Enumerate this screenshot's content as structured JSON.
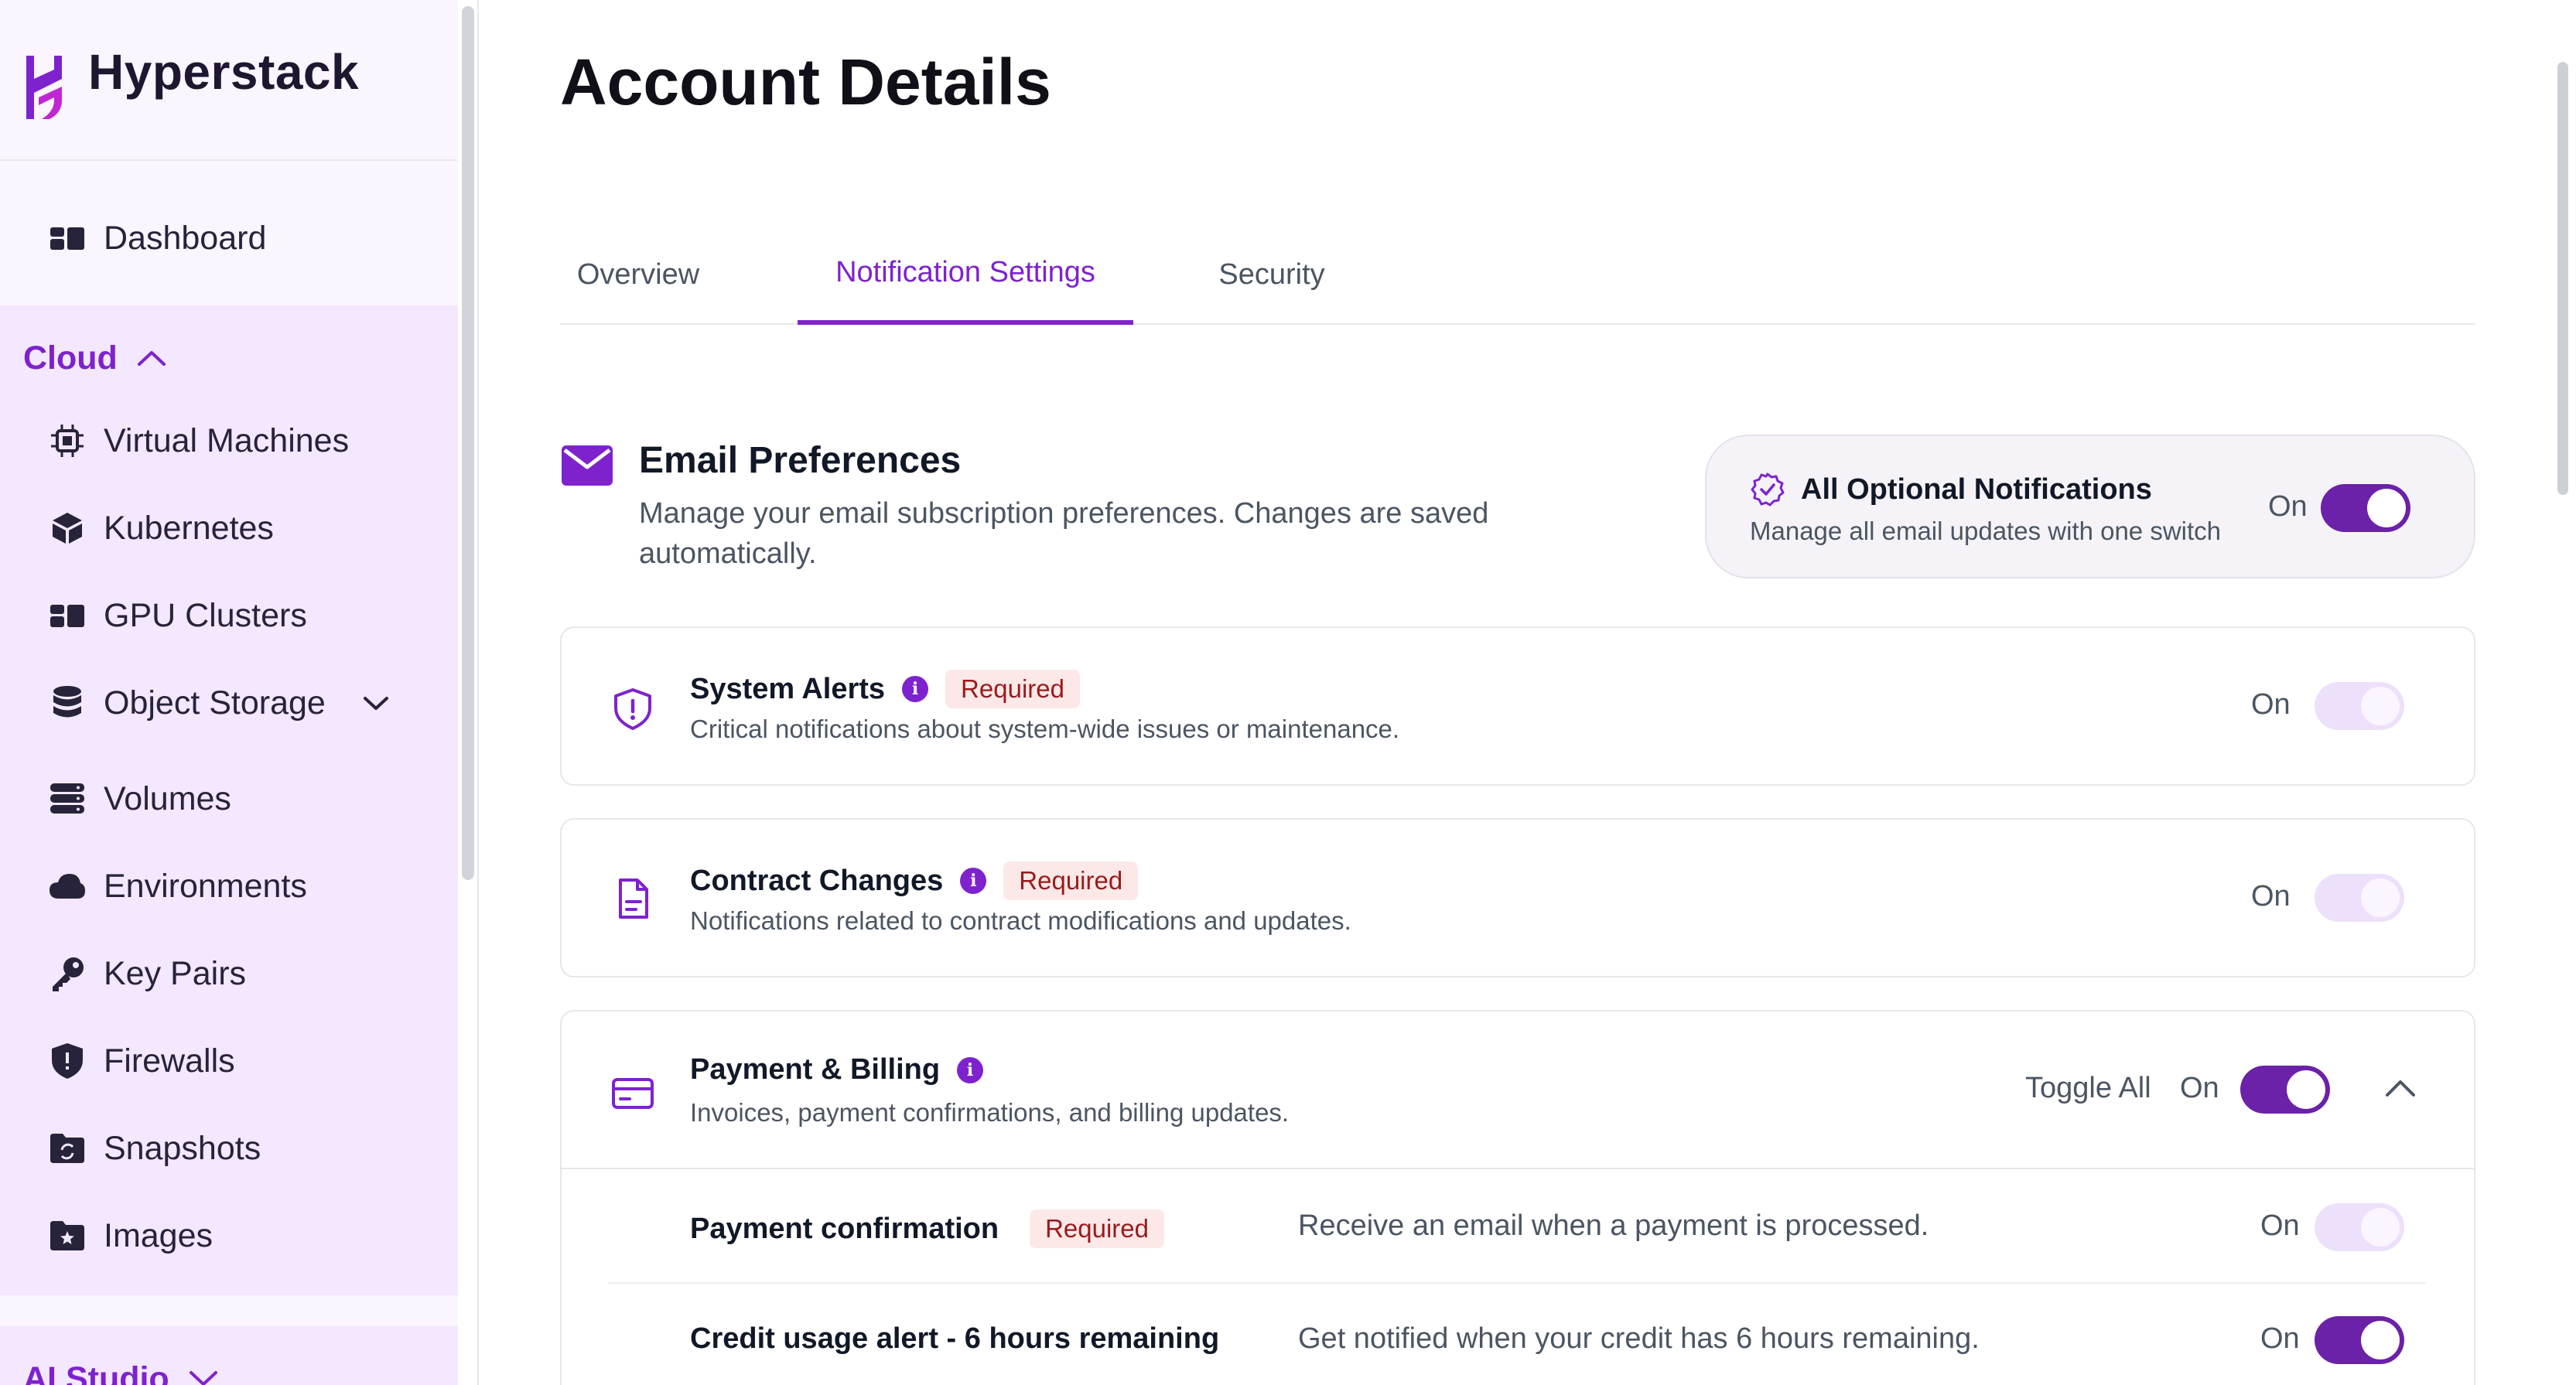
{
  "brand": {
    "name": "Hyperstack",
    "accent": "#7e22ce"
  },
  "sidebar": {
    "dashboard": {
      "label": "Dashboard",
      "icon": "dashboard-icon"
    },
    "cloud": {
      "label": "Cloud",
      "items": [
        {
          "label": "Virtual Machines",
          "icon": "cpu-chip-icon"
        },
        {
          "label": "Kubernetes",
          "icon": "cube-icon"
        },
        {
          "label": "GPU Clusters",
          "icon": "grid-icon"
        },
        {
          "label": "Object Storage",
          "icon": "database-icon"
        },
        {
          "label": "Volumes",
          "icon": "server-stack-icon"
        },
        {
          "label": "Environments",
          "icon": "cloud-icon"
        },
        {
          "label": "Key Pairs",
          "icon": "key-icon"
        },
        {
          "label": "Firewalls",
          "icon": "shield-icon"
        },
        {
          "label": "Snapshots",
          "icon": "folder-sync-icon"
        },
        {
          "label": "Images",
          "icon": "folder-star-icon"
        }
      ]
    },
    "ai_studio": {
      "label": "AI Studio"
    }
  },
  "page": {
    "title": "Account Details"
  },
  "tabs": [
    {
      "label": "Overview",
      "active": false
    },
    {
      "label": "Notification Settings",
      "active": true
    },
    {
      "label": "Security",
      "active": false
    }
  ],
  "email_prefs": {
    "title": "Email Preferences",
    "description": "Manage your email subscription preferences. Changes are saved automatically."
  },
  "optional": {
    "title": "All Optional Notifications",
    "description": "Manage all email updates with one switch",
    "state_label": "On"
  },
  "cards": {
    "system_alerts": {
      "title": "System Alerts",
      "badge": "Required",
      "description": "Critical notifications about system-wide issues or maintenance.",
      "state_label": "On"
    },
    "contract_changes": {
      "title": "Contract Changes",
      "badge": "Required",
      "description": "Notifications related to contract modifications and updates.",
      "state_label": "On"
    },
    "payment_billing": {
      "title": "Payment & Billing",
      "description": "Invoices, payment confirmations, and billing updates.",
      "toggle_all_label": "Toggle All",
      "state_label": "On",
      "items": [
        {
          "title": "Payment confirmation",
          "badge": "Required",
          "description": "Receive an email when a payment is processed.",
          "state_label": "On"
        },
        {
          "title": "Credit usage alert - 6 hours remaining",
          "description": "Get notified when your credit has 6 hours remaining.",
          "state_label": "On"
        }
      ]
    }
  },
  "info_glyph": "i"
}
